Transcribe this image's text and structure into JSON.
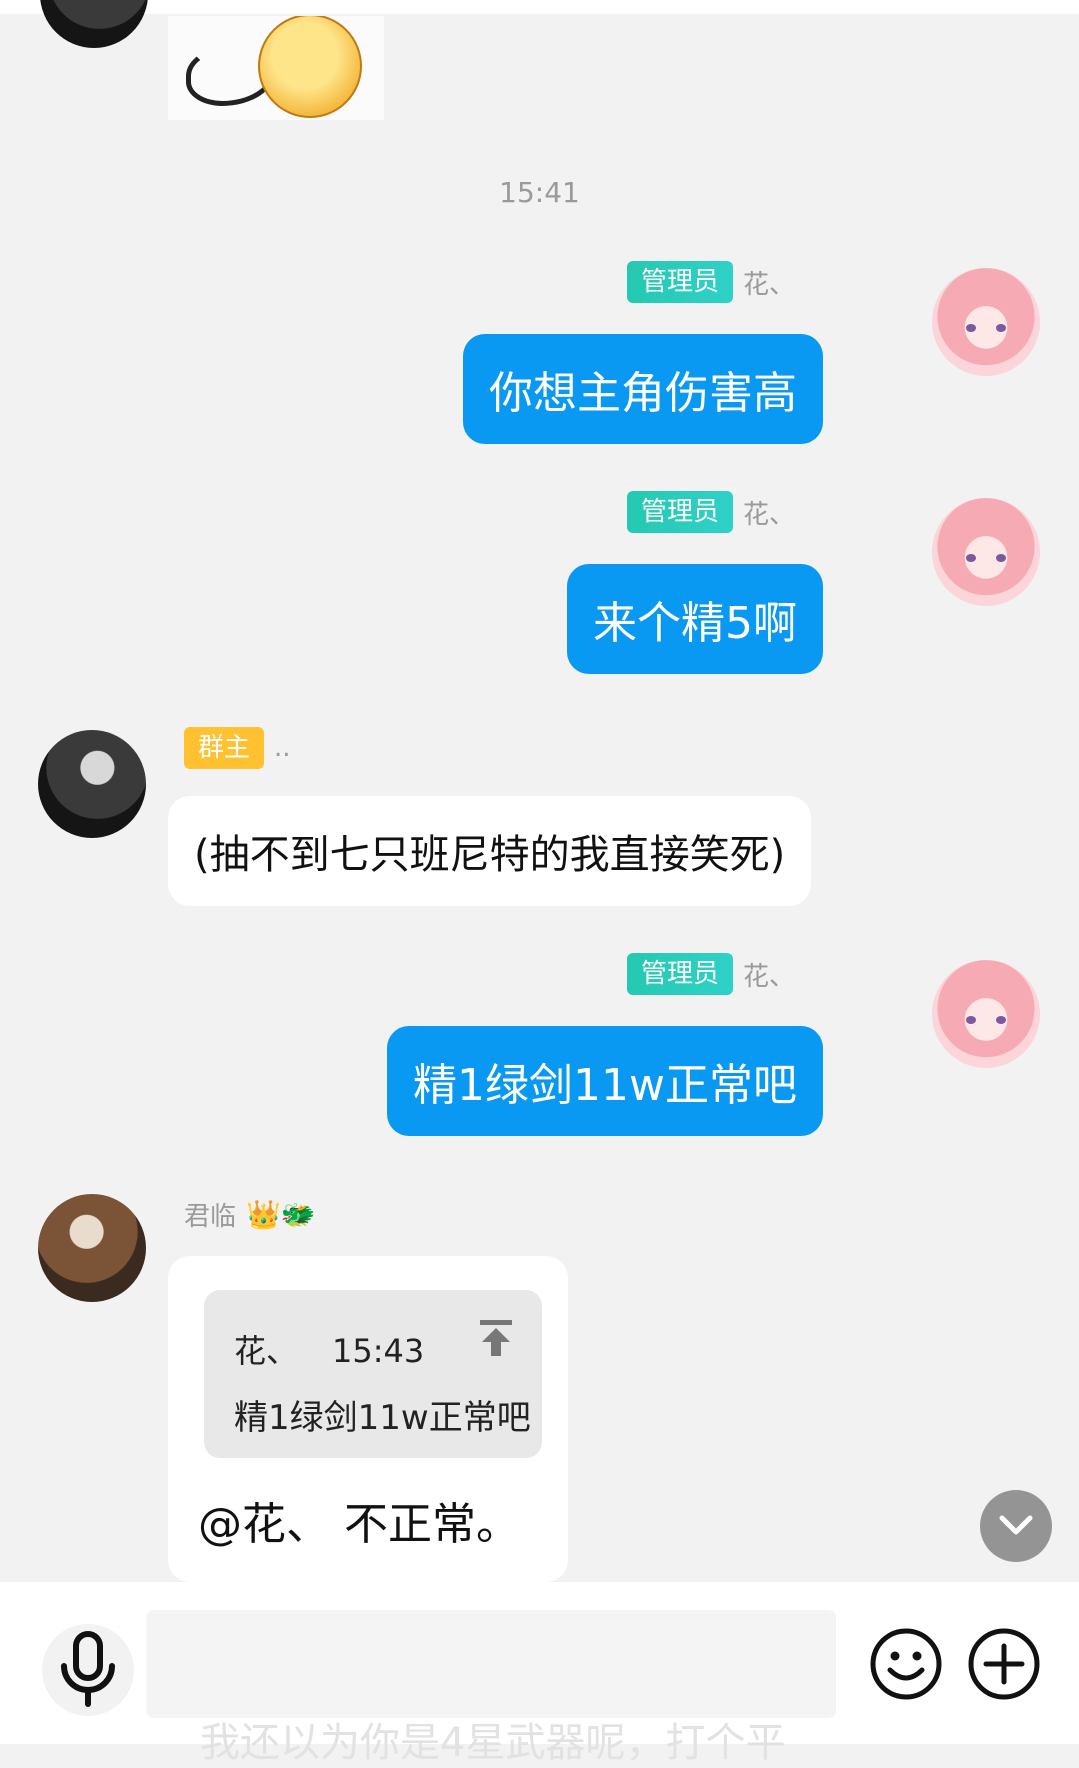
{
  "chat": {
    "timestamp": "15:41",
    "messages": [
      {
        "sender_badge": "管理员",
        "sender_name": "花、",
        "text": "你想主角伤害高"
      },
      {
        "sender_badge": "管理员",
        "sender_name": "花、",
        "text": "来个精5啊"
      },
      {
        "sender_badge": "群主",
        "sender_name": "..",
        "text": "(抽不到七只班尼特的我直接笑死)"
      },
      {
        "sender_badge": "管理员",
        "sender_name": "花、",
        "text": "精1绿剑11w正常吧"
      },
      {
        "sender_name": "君临",
        "sender_decor": "👑🐲",
        "quote": {
          "name": "花、",
          "time": "15:43",
          "text": "精1绿剑11w正常吧"
        },
        "text": "@花、 不正常。"
      }
    ]
  },
  "input": {
    "ghost_text": "我还以为你是4星武器呢，打个平"
  },
  "icons": {
    "mic": "microphone-icon",
    "emoji": "smiley-icon",
    "plus": "plus-circle-icon",
    "scroll": "chevron-down-icon",
    "quote_jump": "jump-to-top-icon"
  },
  "colors": {
    "outgoing_bubble": "#0a99f2",
    "incoming_bubble": "#ffffff",
    "admin_badge": "#25c9b0",
    "owner_badge": "#ffc12f",
    "background": "#f2f2f2"
  }
}
